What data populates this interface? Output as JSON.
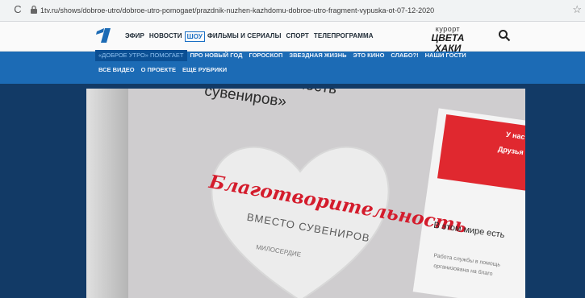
{
  "browser": {
    "url": "1tv.ru/shows/dobroe-utro/dobroe-utro-pomogaet/prazdnik-nuzhen-kazhdomu-dobroe-utro-fragment-vypuska-ot-07-12-2020"
  },
  "site": {
    "main_nav": [
      "ЭФИР",
      "НОВОСТИ",
      "ШОУ",
      "ФИЛЬМЫ И СЕРИАЛЫ",
      "СПОРТ",
      "ТЕЛЕПРОГРАММА"
    ],
    "promo_line1": "курорт",
    "promo_line2": "ЦВЕТА ХАКИ"
  },
  "subnav": {
    "row1": [
      "«ДОБРОЕ УТРО» ПОМОГАЕТ",
      "ПРО НОВЫЙ ГОД",
      "ГОРОСКОП",
      "ЗВЕЗДНАЯ ЖИЗНЬ",
      "ЭТО КИНО",
      "СЛАБО?!",
      "НАШИ ГОСТИ"
    ],
    "row2": [
      "ВСЕ ВИДЕО",
      "О ПРОЕКТЕ",
      "ЕЩЕ РУБРИКИ"
    ]
  },
  "video": {
    "headline_line1": "рительность",
    "headline_line2": "сувениров»",
    "heart_title": "Благотворительность",
    "heart_subtitle": "ВМЕСТО СУВЕНИРОВ",
    "brand": "МИЛОСЕРДИЕ",
    "red_card_line1": "У нас л",
    "red_card_line2": "Друзья",
    "side_title": "В этом мире есть",
    "side_text1": "Работа службы в помощь",
    "side_text2": "организована на благо"
  },
  "colors": {
    "accent": "#1c6bb5",
    "active_tab_bg": "#0b4f93",
    "heart_red": "#d41c2c",
    "page_bg": "#123a66"
  }
}
